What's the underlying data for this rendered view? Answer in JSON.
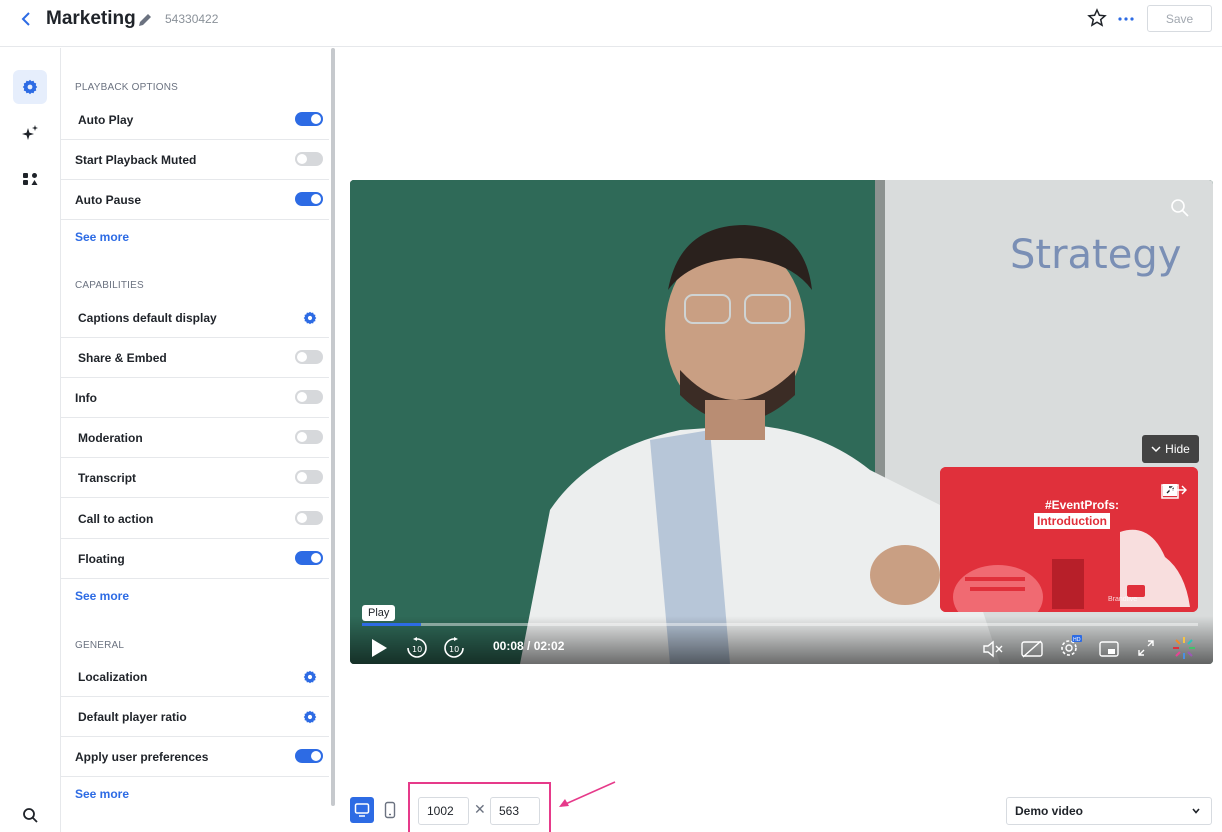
{
  "header": {
    "title": "Marketing",
    "page_id": "54330422",
    "save_label": "Save"
  },
  "rail": {
    "items": [
      {
        "icon": "gear-icon",
        "active": true
      },
      {
        "icon": "sparkle-icon",
        "active": false
      },
      {
        "icon": "apps-icon",
        "active": false
      }
    ],
    "bottom_icon": "search-icon"
  },
  "sections": [
    {
      "title": "PLAYBACK OPTIONS",
      "items": [
        {
          "label": "Auto Play",
          "control": "toggle",
          "on": true
        },
        {
          "label": "Start Playback Muted",
          "control": "toggle",
          "on": false
        },
        {
          "label": "Auto Pause",
          "control": "toggle",
          "on": true
        }
      ],
      "see_more": "See more"
    },
    {
      "title": "CAPABILITIES",
      "items": [
        {
          "label": "Captions default display",
          "control": "gear"
        },
        {
          "label": "Share & Embed",
          "control": "toggle",
          "on": false
        },
        {
          "label": "Info",
          "control": "toggle",
          "on": false
        },
        {
          "label": "Moderation",
          "control": "toggle",
          "on": false
        },
        {
          "label": "Transcript",
          "control": "toggle",
          "on": false
        },
        {
          "label": "Call to action",
          "control": "toggle",
          "on": false
        },
        {
          "label": "Floating",
          "control": "toggle",
          "on": true
        }
      ],
      "see_more": "See more"
    },
    {
      "title": "GENERAL",
      "items": [
        {
          "label": "Localization",
          "control": "gear"
        },
        {
          "label": "Default player ratio",
          "control": "gear"
        },
        {
          "label": "Apply user preferences",
          "control": "toggle",
          "on": true
        }
      ],
      "see_more": "See more"
    }
  ],
  "player": {
    "time": "00:08 / 02:02",
    "progress": 0.07,
    "tooltip": "Play",
    "hide_label": "Hide",
    "whiteboard_text": "Strategy",
    "floating_card": {
      "hashtag": "#EventProfs:",
      "title": "Introduction",
      "brand": "Brandlive"
    },
    "accent_color": "#2d6be4"
  },
  "bottom": {
    "width": "1002",
    "height": "563",
    "times_symbol": "✕",
    "demo_select": "Demo video"
  }
}
